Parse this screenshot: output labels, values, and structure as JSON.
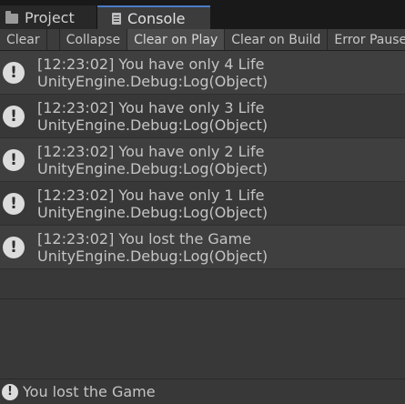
{
  "tabs": [
    {
      "label": "Project",
      "icon": "folder-icon"
    },
    {
      "label": "Console",
      "icon": "console-icon",
      "active": true
    }
  ],
  "toolbar": {
    "clear": "Clear",
    "collapse": "Collapse",
    "clear_on_play": "Clear on Play",
    "clear_on_build": "Clear on Build",
    "error_pause": "Error Pause"
  },
  "logs": [
    {
      "message": "[12:23:02] You have only 4 Life",
      "detail": "UnityEngine.Debug:Log(Object)",
      "icon": "info-icon"
    },
    {
      "message": "[12:23:02] You have only 3 Life",
      "detail": "UnityEngine.Debug:Log(Object)",
      "icon": "info-icon"
    },
    {
      "message": "[12:23:02] You have only 2 Life",
      "detail": "UnityEngine.Debug:Log(Object)",
      "icon": "info-icon"
    },
    {
      "message": "[12:23:02] You have only 1 Life",
      "detail": "UnityEngine.Debug:Log(Object)",
      "icon": "info-icon"
    },
    {
      "message": "[12:23:02] You lost the Game",
      "detail": "UnityEngine.Debug:Log(Object)",
      "icon": "info-icon"
    }
  ],
  "statusbar": {
    "message": "You lost the Game",
    "icon": "info-icon"
  },
  "colors": {
    "tab_accent": "#4a7bc8",
    "background": "#383838",
    "row_alt": "#3f3f3f"
  }
}
